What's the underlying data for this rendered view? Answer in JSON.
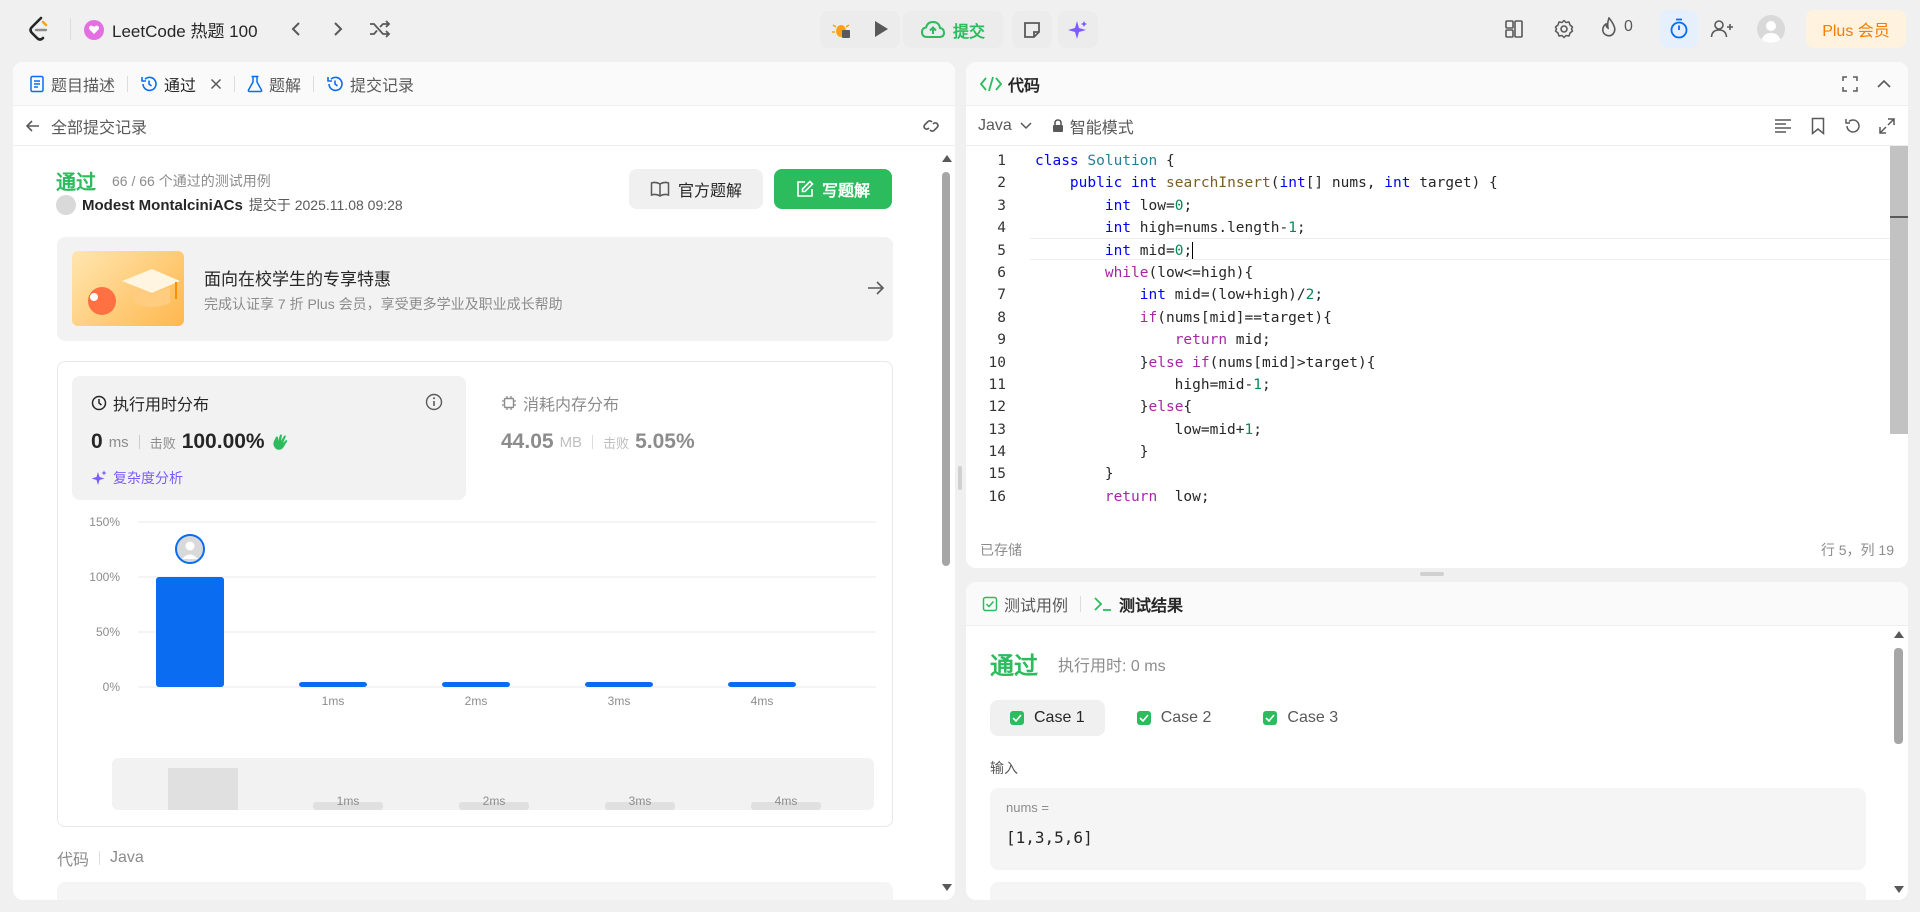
{
  "topbar": {
    "title": "LeetCode 热题 100",
    "submit_label": "提交",
    "streak_count": "0",
    "plus_label": "Plus 会员"
  },
  "left": {
    "tabs": [
      {
        "label": "题目描述"
      },
      {
        "label": "通过"
      },
      {
        "label": "题解"
      },
      {
        "label": "提交记录"
      }
    ],
    "back_label": "全部提交记录",
    "status": "通过",
    "testcases": "66 / 66 个通过的测试用例",
    "username": "Modest MontalciniACs",
    "submitted_at": "提交于 2025.11.08 09:28",
    "official_solution_label": "官方题解",
    "write_solution_label": "写题解",
    "promo": {
      "title": "面向在校学生的专享特惠",
      "subtitle": "完成认证享 7 折 Plus 会员，享受更多学业及职业成长帮助"
    },
    "runtime": {
      "title": "执行用时分布",
      "value": "0",
      "unit": "ms",
      "beats_label": "击败",
      "beats": "100.00%",
      "complexity_label": "复杂度分析"
    },
    "memory": {
      "title": "消耗内存分布",
      "value": "44.05",
      "unit": "MB",
      "beats_label": "击败",
      "beats": "5.05%"
    },
    "code_label": "代码",
    "code_lang": "Java"
  },
  "chart_data": {
    "type": "bar",
    "categories": [
      "0ms",
      "1ms",
      "2ms",
      "3ms",
      "4ms"
    ],
    "values": [
      100,
      2,
      2,
      2,
      2
    ],
    "ylim": [
      0,
      150
    ],
    "yticks": [
      "150%",
      "100%",
      "50%",
      "0%"
    ],
    "xticks": [
      "",
      "1ms",
      "2ms",
      "3ms",
      "4ms"
    ],
    "minimap_ticks": [
      "1ms",
      "2ms",
      "3ms",
      "4ms"
    ],
    "bar_color": "#0a6cf0"
  },
  "editor": {
    "header": "代码",
    "language": "Java",
    "mode": "智能模式",
    "saved": "已存储",
    "cursor": "行 5，列 19",
    "line_numbers": [
      "1",
      "2",
      "3",
      "4",
      "5",
      "6",
      "7",
      "8",
      "9",
      "10",
      "11",
      "12",
      "13",
      "14",
      "15",
      "16"
    ]
  },
  "results": {
    "tab_testcase": "测试用例",
    "tab_result": "测试结果",
    "status": "通过",
    "runtime": "执行用时: 0 ms",
    "cases": [
      "Case 1",
      "Case 2",
      "Case 3"
    ],
    "input_label": "输入",
    "var_name": "nums =",
    "var_value": "[1,3,5,6]"
  },
  "colors": {
    "accent_green": "#2cbb5d",
    "accent_blue": "#0a6cf0",
    "plus_bg": "#fff3e0",
    "plus_text": "#f57c00"
  }
}
